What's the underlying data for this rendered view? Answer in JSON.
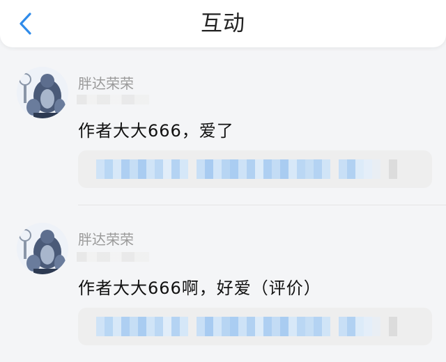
{
  "header": {
    "title": "互动",
    "back_icon": "chevron-left-icon"
  },
  "colors": {
    "accent": "#2f8bea",
    "header_bg": "#ffffff",
    "page_bg": "#f4f5f7",
    "quote_bg": "#eeeeee"
  },
  "comments": [
    {
      "username": "胖达荣荣",
      "text": "作者大大666，爱了",
      "quote_blurred": true
    },
    {
      "username": "胖达荣荣",
      "text": "作者大大666啊，好爱（评价）",
      "quote_blurred": true
    }
  ]
}
